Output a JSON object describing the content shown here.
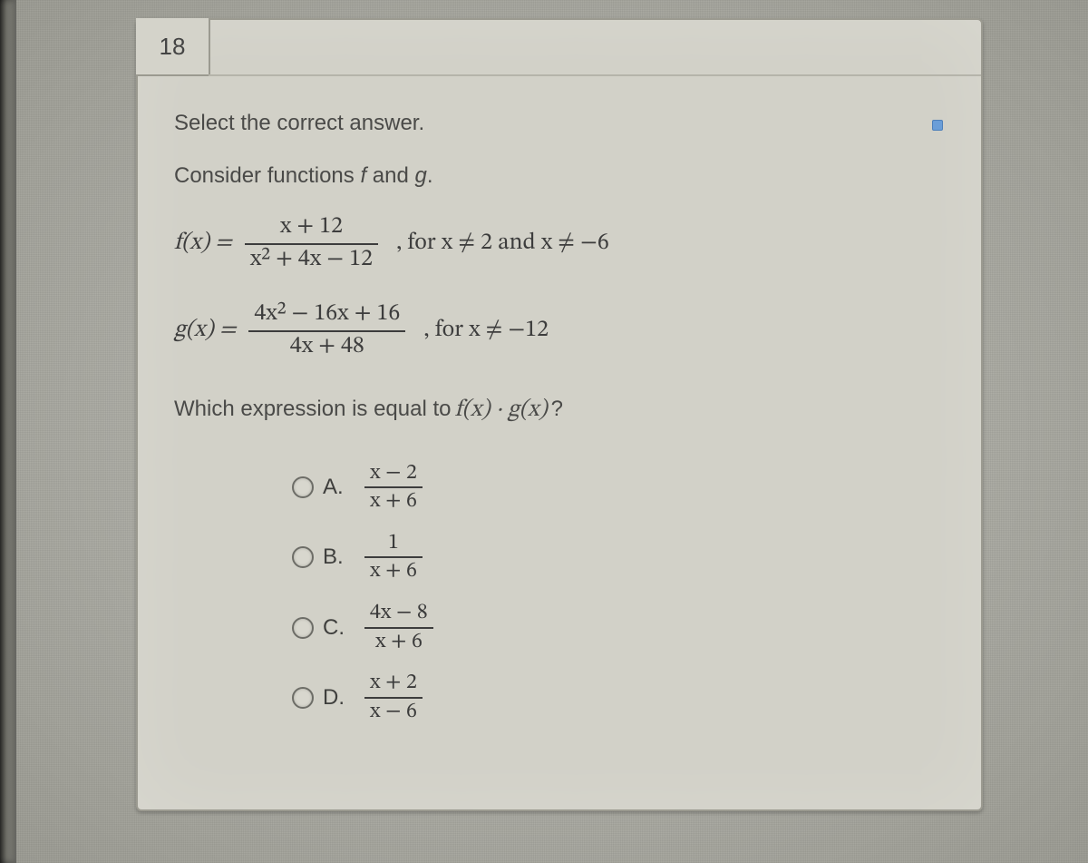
{
  "question_number": "18",
  "instruction": "Select the correct answer.",
  "consider_prefix": "Consider functions ",
  "consider_f": "f",
  "consider_mid": " and ",
  "consider_g": "g",
  "consider_suffix": ".",
  "f": {
    "lhs": "f(x) = ",
    "num": "x + 12",
    "den": "x² + 4x − 12",
    "cond": ", for x ≠ 2 and x ≠ −6"
  },
  "g": {
    "lhs": "g(x) = ",
    "num": "4x² − 16x + 16",
    "den": "4x + 48",
    "cond": ", for x ≠ −12"
  },
  "which_prefix": "Which expression is equal to ",
  "which_expr": "f(x) · g(x)",
  "which_q": "?",
  "options": {
    "A": {
      "label": "A.",
      "num": "x − 2",
      "den": "x + 6"
    },
    "B": {
      "label": "B.",
      "num": "1",
      "den": "x + 6"
    },
    "C": {
      "label": "C.",
      "num": "4x − 8",
      "den": "x + 6"
    },
    "D": {
      "label": "D.",
      "num": "x + 2",
      "den": "x − 6"
    }
  }
}
